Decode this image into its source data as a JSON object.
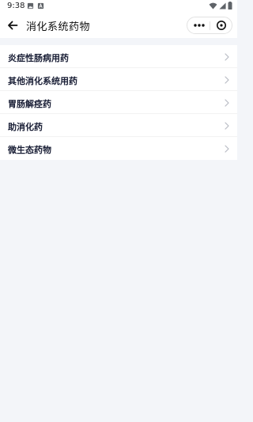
{
  "status_bar": {
    "time": "9:38",
    "icons": [
      "image-icon",
      "text-icon",
      "wifi-icon",
      "signal-icon",
      "battery-icon"
    ]
  },
  "header": {
    "title": "消化系统药物",
    "back_icon": "arrow-left-icon",
    "more_icon": "more-dots-icon",
    "close_icon": "close-circle-icon"
  },
  "list": {
    "items": [
      {
        "label": "炎症性肠病用药"
      },
      {
        "label": "其他消化系统用药"
      },
      {
        "label": "胃肠解痉药"
      },
      {
        "label": "助消化药"
      },
      {
        "label": "微生态药物"
      }
    ]
  },
  "colors": {
    "page_background": "#f3f5f9",
    "text_primary": "#1a1f36",
    "chevron": "#b9bcc4"
  }
}
